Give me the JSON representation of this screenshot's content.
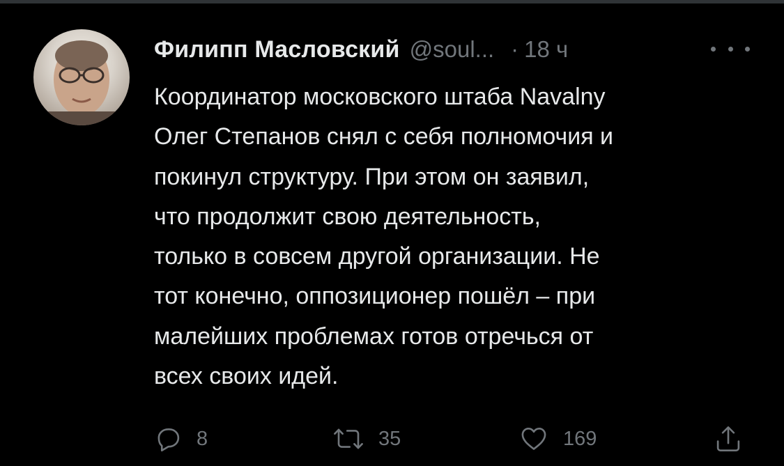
{
  "tweet": {
    "author": {
      "display_name": "Филипп Масловский",
      "handle": "@soul...",
      "avatar": "avatar-photo"
    },
    "separator": "·",
    "time": "18 ч",
    "more_icon": "more-horizontal-icon",
    "text": "Координатор московского штаба Navalny\nОлег Степанов снял с себя полномочия и\nпокинул структуру. При этом он заявил,\nчто продолжит свою деятельность,\nтолько в совсем другой организации. Не\nтот конечно, оппозиционер пошёл – при\nмалейших проблемах готов отречься от\nвсех своих идей.",
    "actions": {
      "reply": {
        "icon": "reply-bubble-icon",
        "count": "8"
      },
      "retweet": {
        "icon": "retweet-icon",
        "count": "35"
      },
      "like": {
        "icon": "heart-icon",
        "count": "169"
      },
      "share": {
        "icon": "share-upload-icon"
      }
    }
  },
  "colors": {
    "background": "#000000",
    "primary_text": "#e7e9ea",
    "secondary_text": "#71767b",
    "divider": "#2f3336"
  }
}
